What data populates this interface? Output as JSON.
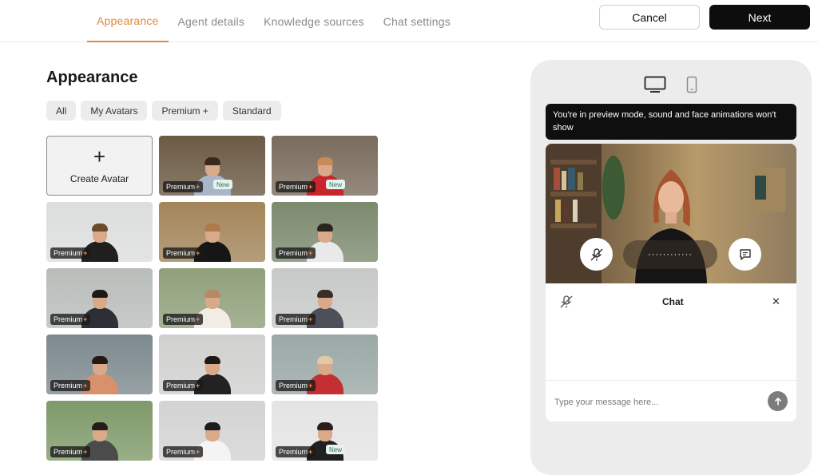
{
  "header": {
    "tabs": [
      {
        "label": "Appearance",
        "active": true
      },
      {
        "label": "Agent details",
        "active": false
      },
      {
        "label": "Knowledge sources",
        "active": false
      },
      {
        "label": "Chat settings",
        "active": false
      }
    ],
    "cancel_label": "Cancel",
    "next_label": "Next"
  },
  "main": {
    "title": "Appearance",
    "filters": [
      "All",
      "My Avatars",
      "Premium +",
      "Standard"
    ],
    "create_avatar_label": "Create Avatar",
    "premium_label": "Premium",
    "premium_plus": "+",
    "new_label": "New",
    "avatars": [
      {
        "scene": "#6b5a44",
        "shirt": "#a9b6c9",
        "hair": "#3a2a1e",
        "new": true
      },
      {
        "scene": "#7a6c5d",
        "shirt": "#c8262c",
        "hair": "#c98a5a",
        "new": true
      },
      {
        "scene": "#dcdedd",
        "shirt": "#1f1f1f",
        "hair": "#6b4a2e",
        "new": false
      },
      {
        "scene": "#a3855a",
        "shirt": "#161616",
        "hair": "#b07a4a",
        "new": false
      },
      {
        "scene": "#7c8a6e",
        "shirt": "#e9e9e9",
        "hair": "#2a2420",
        "new": false
      },
      {
        "scene": "#b9bdba",
        "shirt": "#2c2f36",
        "hair": "#1a1a1a",
        "new": false
      },
      {
        "scene": "#8fa07a",
        "shirt": "#f2ece4",
        "hair": "#b58a62",
        "new": false
      },
      {
        "scene": "#c7c9c8",
        "shirt": "#4d5058",
        "hair": "#3a2e26",
        "new": false
      },
      {
        "scene": "#7d8a8e",
        "shirt": "#d8916a",
        "hair": "#231a16",
        "new": false
      },
      {
        "scene": "#d0d0cf",
        "shirt": "#222222",
        "hair": "#1c1a19",
        "new": false
      },
      {
        "scene": "#9aa8a6",
        "shirt": "#c42f34",
        "hair": "#e1c9a4",
        "new": false
      },
      {
        "scene": "#7f9a6a",
        "shirt": "#4b4b4b",
        "hair": "#241d18",
        "new": false
      },
      {
        "scene": "#d3d3d3",
        "shirt": "#f4f4f4",
        "hair": "#1d1d1d",
        "new": false
      },
      {
        "scene": "#e4e4e4",
        "shirt": "#202020",
        "hair": "#2a1e19",
        "new": true
      }
    ]
  },
  "preview": {
    "desktop_icon": "desktop-icon",
    "mobile_icon": "mobile-icon",
    "notice": "You're in preview mode, sound and face animations won't show",
    "wave_text": "············",
    "chat_title": "Chat",
    "close_glyph": "✕",
    "input_placeholder": "Type your message here..."
  },
  "colors": {
    "accent": "#e0883a",
    "next_button": "#0d0d0d",
    "premium_plus": "#ff8a3c"
  }
}
